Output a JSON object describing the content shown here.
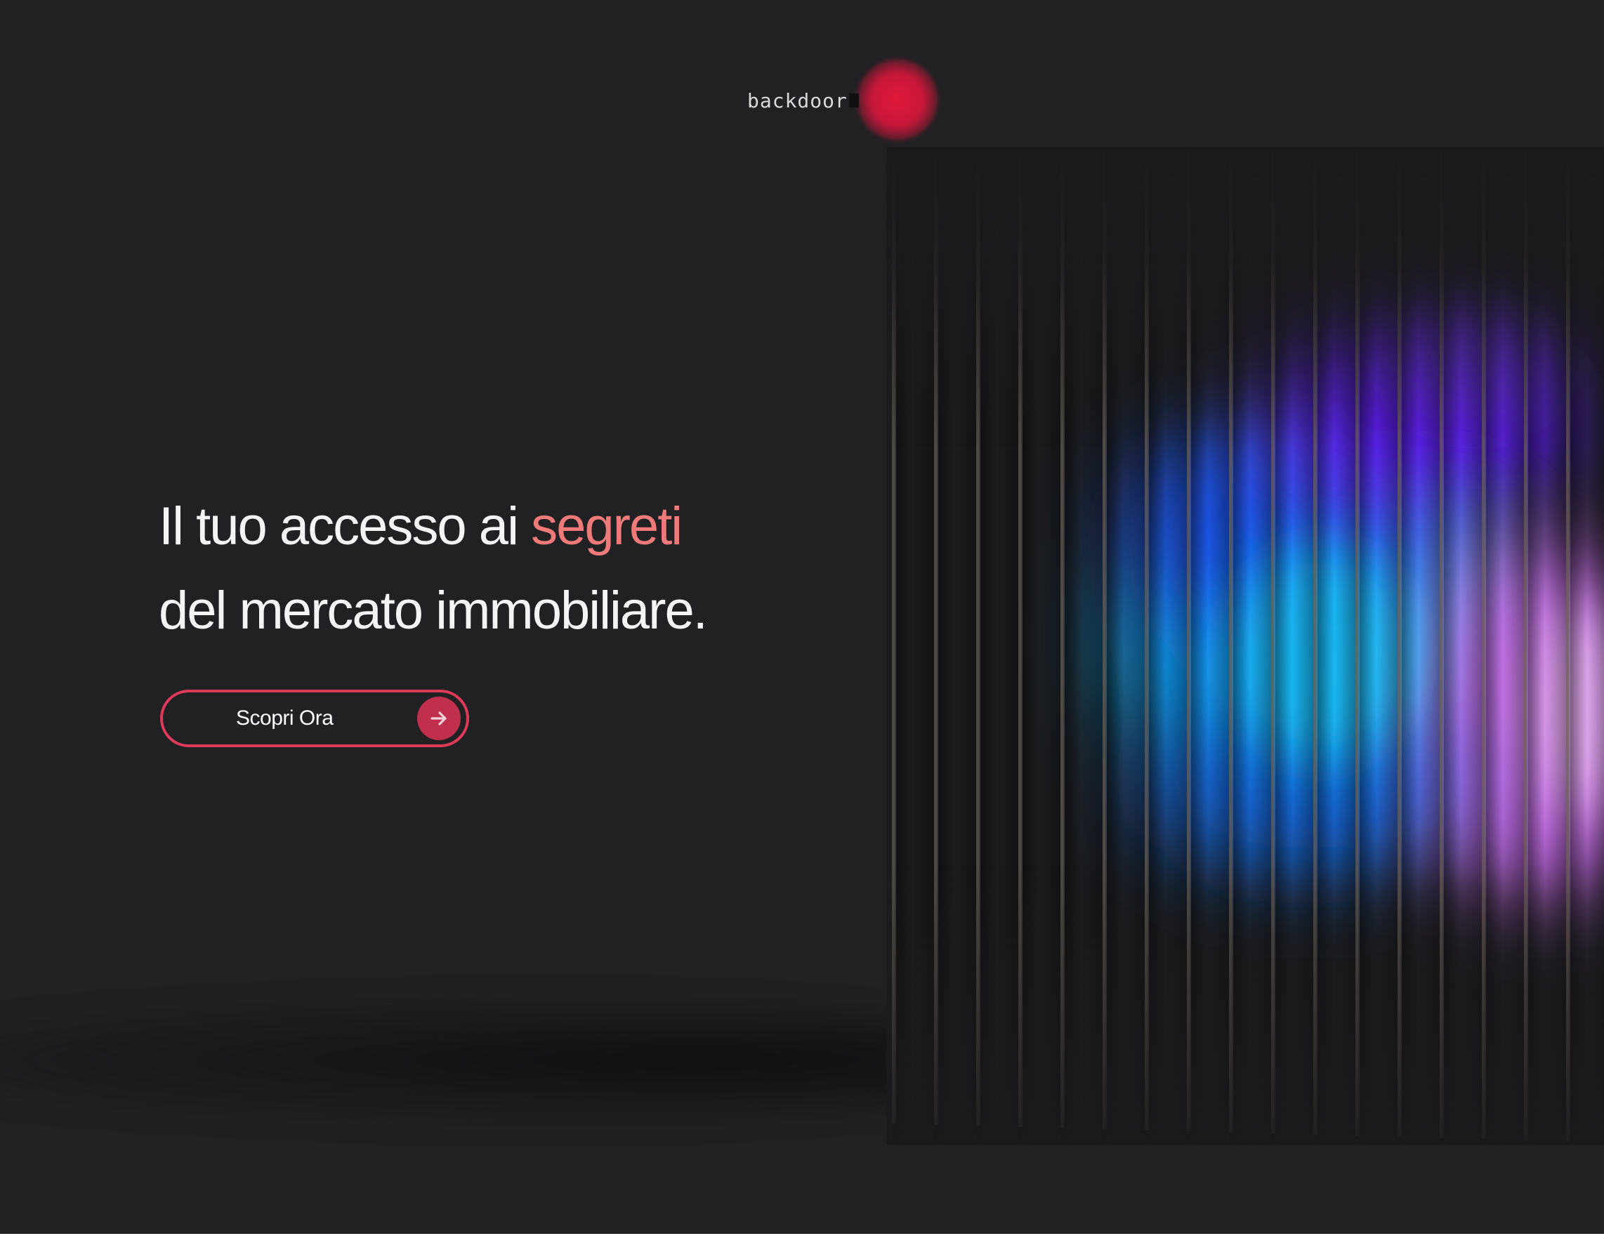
{
  "header": {
    "logo_text": "backdoor"
  },
  "hero": {
    "headline_part1": "Il tuo accesso ai ",
    "headline_accent": "segreti",
    "headline_line2": "del mercato immobiliare."
  },
  "cta": {
    "label": "Scopri Ora",
    "icon": "arrow-right-icon"
  },
  "colors": {
    "background": "#212123",
    "accent_text": "#f07a7a",
    "cta_border": "#e03a5a",
    "cta_icon_bg": "#c0304c",
    "logo_glow": "#d8183a"
  }
}
